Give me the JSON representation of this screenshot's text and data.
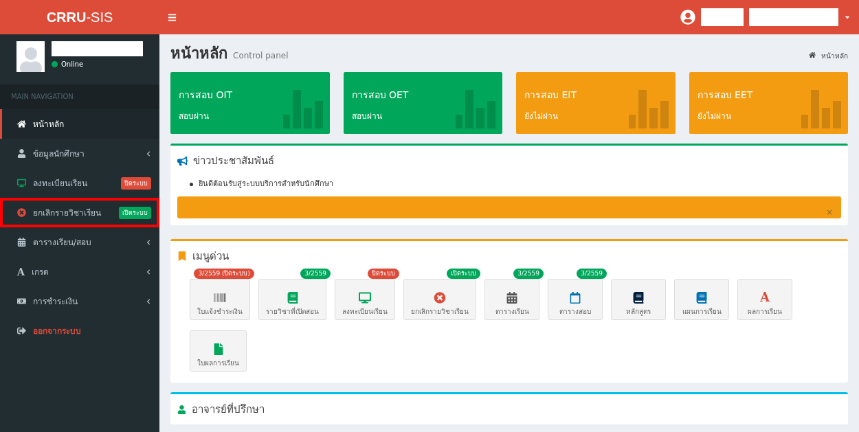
{
  "logo": "**CRRU**-SIS",
  "user_panel": {
    "status": "Online"
  },
  "sidebar": {
    "header": "MAIN NAVIGATION",
    "items": [
      {
        "label": "หน้าหลัก",
        "selected": true,
        "highlighted": false,
        "has_submenu": false,
        "kind": "link"
      },
      {
        "label": "ข้อมูลนักศึกษา",
        "selected": false,
        "highlighted": false,
        "has_submenu": true,
        "kind": "link"
      },
      {
        "label": "ลงทะเบียนเรียน",
        "selected": false,
        "highlighted": false,
        "has_submenu": false,
        "kind": "link",
        "badge": {
          "text": "ปิดระบบ",
          "color": "#dd4b39"
        }
      },
      {
        "label": "ยกเลิกรายวิชาเรียน",
        "selected": false,
        "highlighted": true,
        "has_submenu": false,
        "kind": "link",
        "badge": {
          "text": "เปิดระบบ",
          "color": "#00a65a"
        }
      },
      {
        "label": "ตารางเรียน/สอบ",
        "selected": false,
        "highlighted": false,
        "has_submenu": true,
        "kind": "link"
      },
      {
        "label": "เกรด",
        "selected": false,
        "highlighted": false,
        "has_submenu": true,
        "kind": "link",
        "icon_text": "A"
      },
      {
        "label": "การชำระเงิน",
        "selected": false,
        "highlighted": false,
        "has_submenu": true,
        "kind": "link"
      },
      {
        "label": "ออกจากระบบ",
        "selected": false,
        "highlighted": false,
        "has_submenu": false,
        "kind": "logout"
      }
    ]
  },
  "page": {
    "title": "หน้าหลัก",
    "subtitle": "Control panel",
    "breadcrumb": "หน้าหลัก"
  },
  "info_boxes": [
    {
      "title": "การสอบ OIT",
      "status": "สอบผ่าน",
      "color": "#00a65a"
    },
    {
      "title": "การสอบ OET",
      "status": "สอบผ่าน",
      "color": "#00a65a"
    },
    {
      "title": "การสอบ EIT",
      "status": "ยังไม่ผ่าน",
      "color": "#f39c12"
    },
    {
      "title": "การสอบ EET",
      "status": "ยังไม่ผ่าน",
      "color": "#f39c12"
    }
  ],
  "news": {
    "title": "ข่าวประชาสัมพันธ์",
    "items": [
      "ยินดีต้อนรับสู่ระบบบริการสำหรับนักศึกษา"
    ],
    "alert_close": "×"
  },
  "quick_menu": {
    "title": "เมนูด่วน",
    "items": [
      {
        "label": "ใบแจ้งชำระเงิน",
        "badge": {
          "text": "3/2559 (ปิดระบบ)",
          "color": "#dd4b39"
        }
      },
      {
        "label": "รายวิชาที่เปิดสอน",
        "badge": {
          "text": "3/2559",
          "color": "#00a65a"
        }
      },
      {
        "label": "ลงทะเบียนเรียน",
        "badge": {
          "text": "ปิดระบบ",
          "color": "#dd4b39"
        }
      },
      {
        "label": "ยกเลิกรายวิชาเรียน",
        "badge": {
          "text": "เปิดระบบ",
          "color": "#00a65a"
        }
      },
      {
        "label": "ตารางเรียน",
        "badge": {
          "text": "3/2559",
          "color": "#00a65a"
        }
      },
      {
        "label": "ตารางสอบ",
        "badge": {
          "text": "3/2559",
          "color": "#00a65a"
        }
      },
      {
        "label": "หลักสูตร"
      },
      {
        "label": "แผนการเรียน"
      },
      {
        "label": "ผลการเรียน",
        "icon_text": "A"
      },
      {
        "label": "ใบผลการเรียน"
      }
    ]
  },
  "advisor": {
    "title": "อาจารย์ที่ปรึกษา"
  }
}
